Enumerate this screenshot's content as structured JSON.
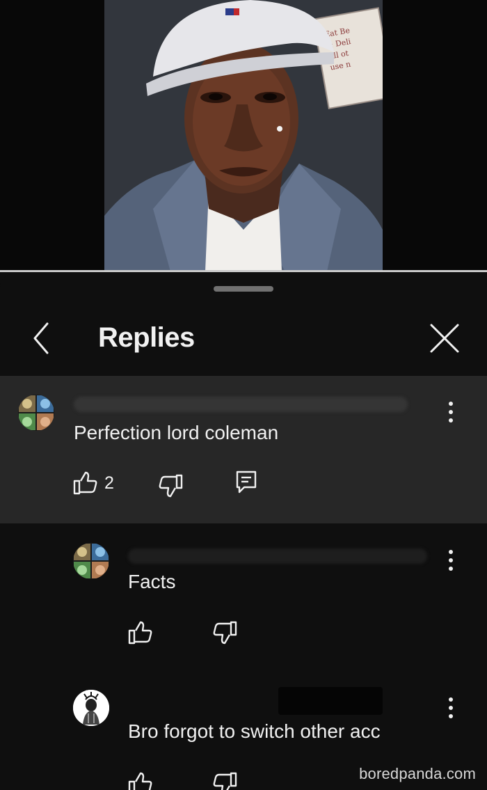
{
  "video": {
    "thumbnail_icon": "portrait-photo",
    "sign_lines": [
      "Eat Be",
      "& Deli",
      "All ot",
      "use n"
    ]
  },
  "panel": {
    "title": "Replies",
    "back_icon": "chevron-left-icon",
    "close_icon": "close-icon"
  },
  "comments": [
    {
      "text": "Perfection lord coleman",
      "likes": "2",
      "avatar_icon": "quadrant-avatar",
      "author_redacted": true,
      "highlighted": true
    },
    {
      "text": "Facts",
      "likes": "",
      "avatar_icon": "quadrant-avatar",
      "author_redacted": true,
      "highlighted": false
    },
    {
      "text": "Bro forgot to switch other acc",
      "likes": "",
      "avatar_icon": "sketch-avatar",
      "author_redacted": true,
      "highlighted": false
    }
  ],
  "watermark": "boredpanda.com",
  "colors": {
    "background": "#0f0f0f",
    "highlight": "#272727",
    "text": "#f1f1f1",
    "icon": "#f1f1f1"
  }
}
